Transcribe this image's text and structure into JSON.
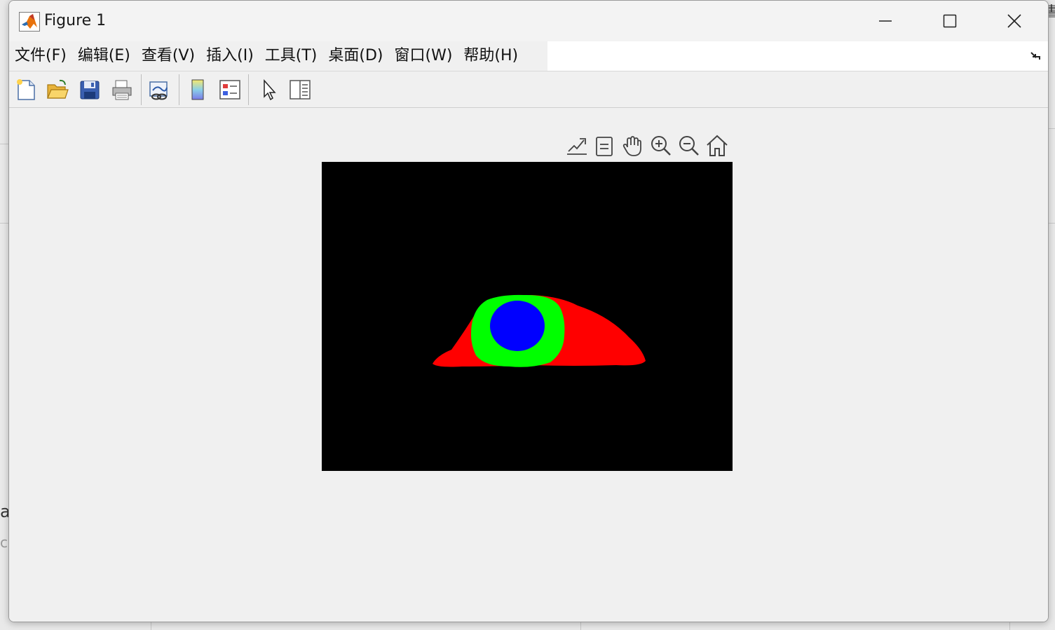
{
  "window": {
    "title": "Figure 1",
    "icon": "matlab-logo-icon"
  },
  "menu": {
    "items": [
      {
        "label": "文件(F)"
      },
      {
        "label": "编辑(E)"
      },
      {
        "label": "查看(V)"
      },
      {
        "label": "插入(I)"
      },
      {
        "label": "工具(T)"
      },
      {
        "label": "桌面(D)"
      },
      {
        "label": "窗口(W)"
      },
      {
        "label": "帮助(H)"
      }
    ]
  },
  "toolbar": {
    "buttons": [
      {
        "icon": "new-figure-icon"
      },
      {
        "icon": "open-file-icon"
      },
      {
        "icon": "save-icon"
      },
      {
        "icon": "print-icon"
      },
      {
        "icon": "link-plot-icon"
      },
      {
        "icon": "colorbar-icon"
      },
      {
        "icon": "legend-icon"
      },
      {
        "icon": "edit-plot-cursor-icon"
      },
      {
        "icon": "property-inspector-icon"
      }
    ]
  },
  "axes_toolbar": {
    "buttons": [
      {
        "icon": "export-icon"
      },
      {
        "icon": "data-tips-icon"
      },
      {
        "icon": "pan-hand-icon"
      },
      {
        "icon": "zoom-in-icon"
      },
      {
        "icon": "zoom-out-icon"
      },
      {
        "icon": "home-restore-view-icon"
      }
    ]
  },
  "image": {
    "background": "#000000",
    "regions": {
      "outer": "#ff0000",
      "middle": "#00ff00",
      "inner": "#0000ff"
    }
  },
  "background_fragments": {
    "top_right_char": "書",
    "left_char_1": "a",
    "left_char_2": "ci"
  },
  "colors": {
    "window_bg": "#f0f0f0",
    "close_hover": "#e81123"
  }
}
